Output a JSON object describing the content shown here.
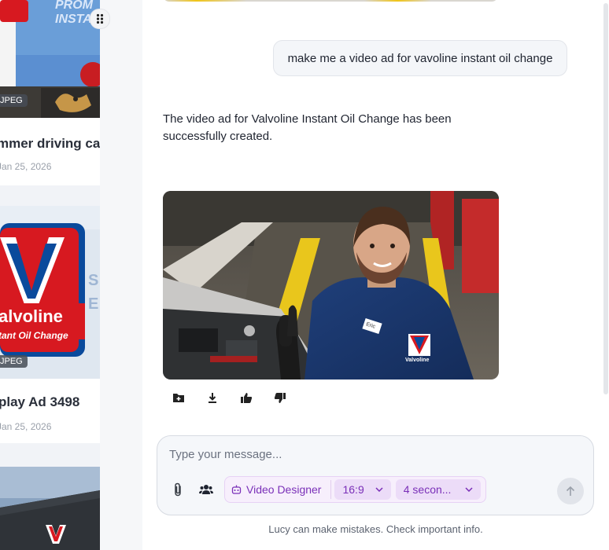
{
  "gallery": {
    "cards": [
      {
        "title": "mmer driving ca",
        "date": "Jan 25, 2026",
        "badge": "JPEG",
        "banner_text": "PROM\nINSTA"
      },
      {
        "title": "play Ad 3498",
        "date": "Jan 25, 2026",
        "badge": "JPEG",
        "logo_text": "alvoline",
        "logo_sub": "tant Oil Change",
        "side_text": "S\nE"
      },
      {
        "title": "",
        "date": "",
        "badge": ""
      }
    ]
  },
  "conversation": {
    "user_message": "make me a video ad for vavoline instant oil change",
    "assistant_message": "The video ad for Valvoline Instant Oil Change has been successfully created.",
    "image_logo_text": "Valvoline",
    "image_name_tag": "Eric"
  },
  "composer": {
    "placeholder": "Type your message...",
    "mode_label": "Video Designer",
    "aspect_ratio": "16:9",
    "duration": "4 secon...",
    "disclaimer": "Lucy can make mistakes. Check important info."
  },
  "colors": {
    "accent_purple": "#7a2fb8",
    "valvoline_red": "#d71920",
    "valvoline_blue": "#0a4a9c"
  },
  "icons": {
    "drag": "drag-handle-icon",
    "add_folder": "folder-plus-icon",
    "download": "download-icon",
    "like": "thumbs-up-icon",
    "dislike": "thumbs-down-icon",
    "attach": "paperclip-icon",
    "people": "people-icon",
    "mode": "robot-icon",
    "chevron": "chevron-down-icon",
    "send": "arrow-up-icon"
  }
}
